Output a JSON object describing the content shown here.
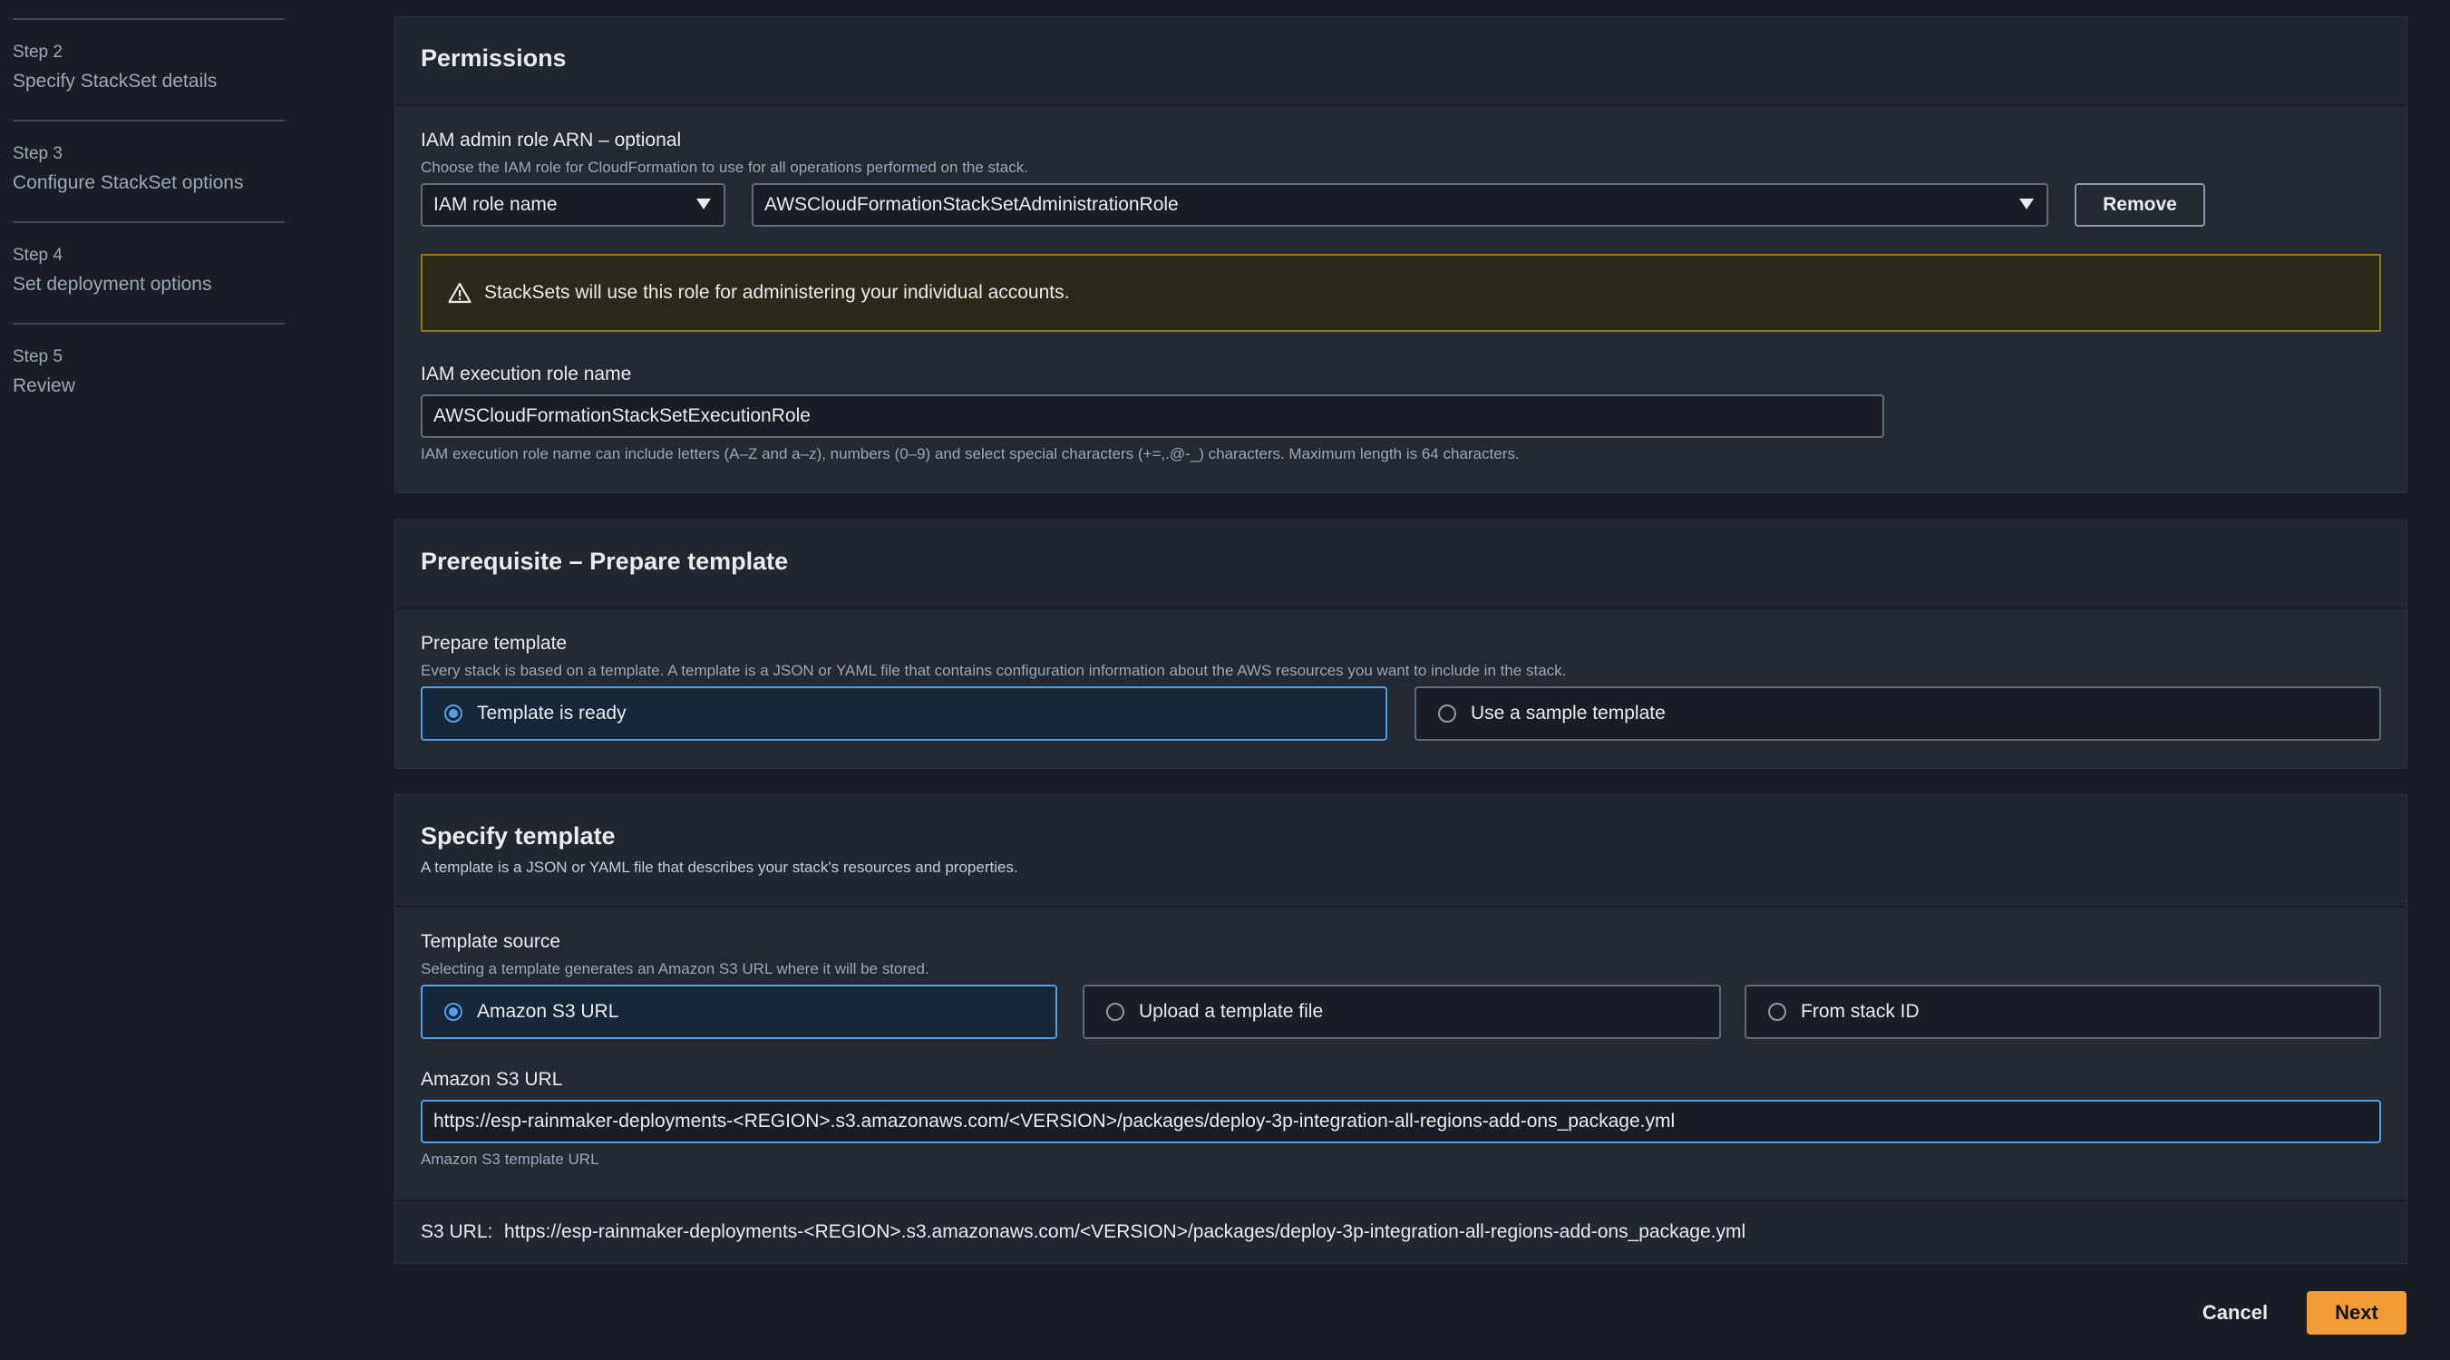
{
  "sidebar": {
    "steps": [
      {
        "num": "Step 2",
        "title": "Specify StackSet details"
      },
      {
        "num": "Step 3",
        "title": "Configure StackSet options"
      },
      {
        "num": "Step 4",
        "title": "Set deployment options"
      },
      {
        "num": "Step 5",
        "title": "Review"
      }
    ]
  },
  "permissions": {
    "title": "Permissions",
    "admin_role_label": "IAM admin role ARN – optional",
    "admin_role_desc": "Choose the IAM role for CloudFormation to use for all operations performed on the stack.",
    "role_type_value": "IAM role name",
    "role_name_value": "AWSCloudFormationStackSetAdministrationRole",
    "remove_label": "Remove",
    "alert_text": "StackSets will use this role for administering your individual accounts.",
    "exec_role_label": "IAM execution role name",
    "exec_role_value": "AWSCloudFormationStackSetExecutionRole",
    "exec_role_hint": "IAM execution role name can include letters (A–Z and a–z), numbers (0–9) and select special characters (+=,.@-_) characters. Maximum length is 64 characters."
  },
  "prerequisite": {
    "title": "Prerequisite – Prepare template",
    "label": "Prepare template",
    "desc": "Every stack is based on a template. A template is a JSON or YAML file that contains configuration information about the AWS resources you want to include in the stack.",
    "options": [
      "Template is ready",
      "Use a sample template"
    ],
    "selected": "Template is ready"
  },
  "specify": {
    "title": "Specify template",
    "subtitle": "A template is a JSON or YAML file that describes your stack's resources and properties.",
    "source_label": "Template source",
    "source_desc": "Selecting a template generates an Amazon S3 URL where it will be stored.",
    "sources": [
      "Amazon S3 URL",
      "Upload a template file",
      "From stack ID"
    ],
    "selected": "Amazon S3 URL",
    "url_label": "Amazon S3 URL",
    "url_value": "https://esp-rainmaker-deployments-<REGION>.s3.amazonaws.com/<VERSION>/packages/deploy-3p-integration-all-regions-add-ons_package.yml",
    "url_hint": "Amazon S3 template URL",
    "s3_url_label": "S3 URL:",
    "s3_url_value": "https://esp-rainmaker-deployments-<REGION>.s3.amazonaws.com/<VERSION>/packages/deploy-3p-integration-all-regions-add-ons_package.yml"
  },
  "footer": {
    "cancel_label": "Cancel",
    "next_label": "Next"
  },
  "colors": {
    "accent": "#539fe5",
    "primary_button": "#f29c36",
    "warning_border": "#8f7a19"
  }
}
